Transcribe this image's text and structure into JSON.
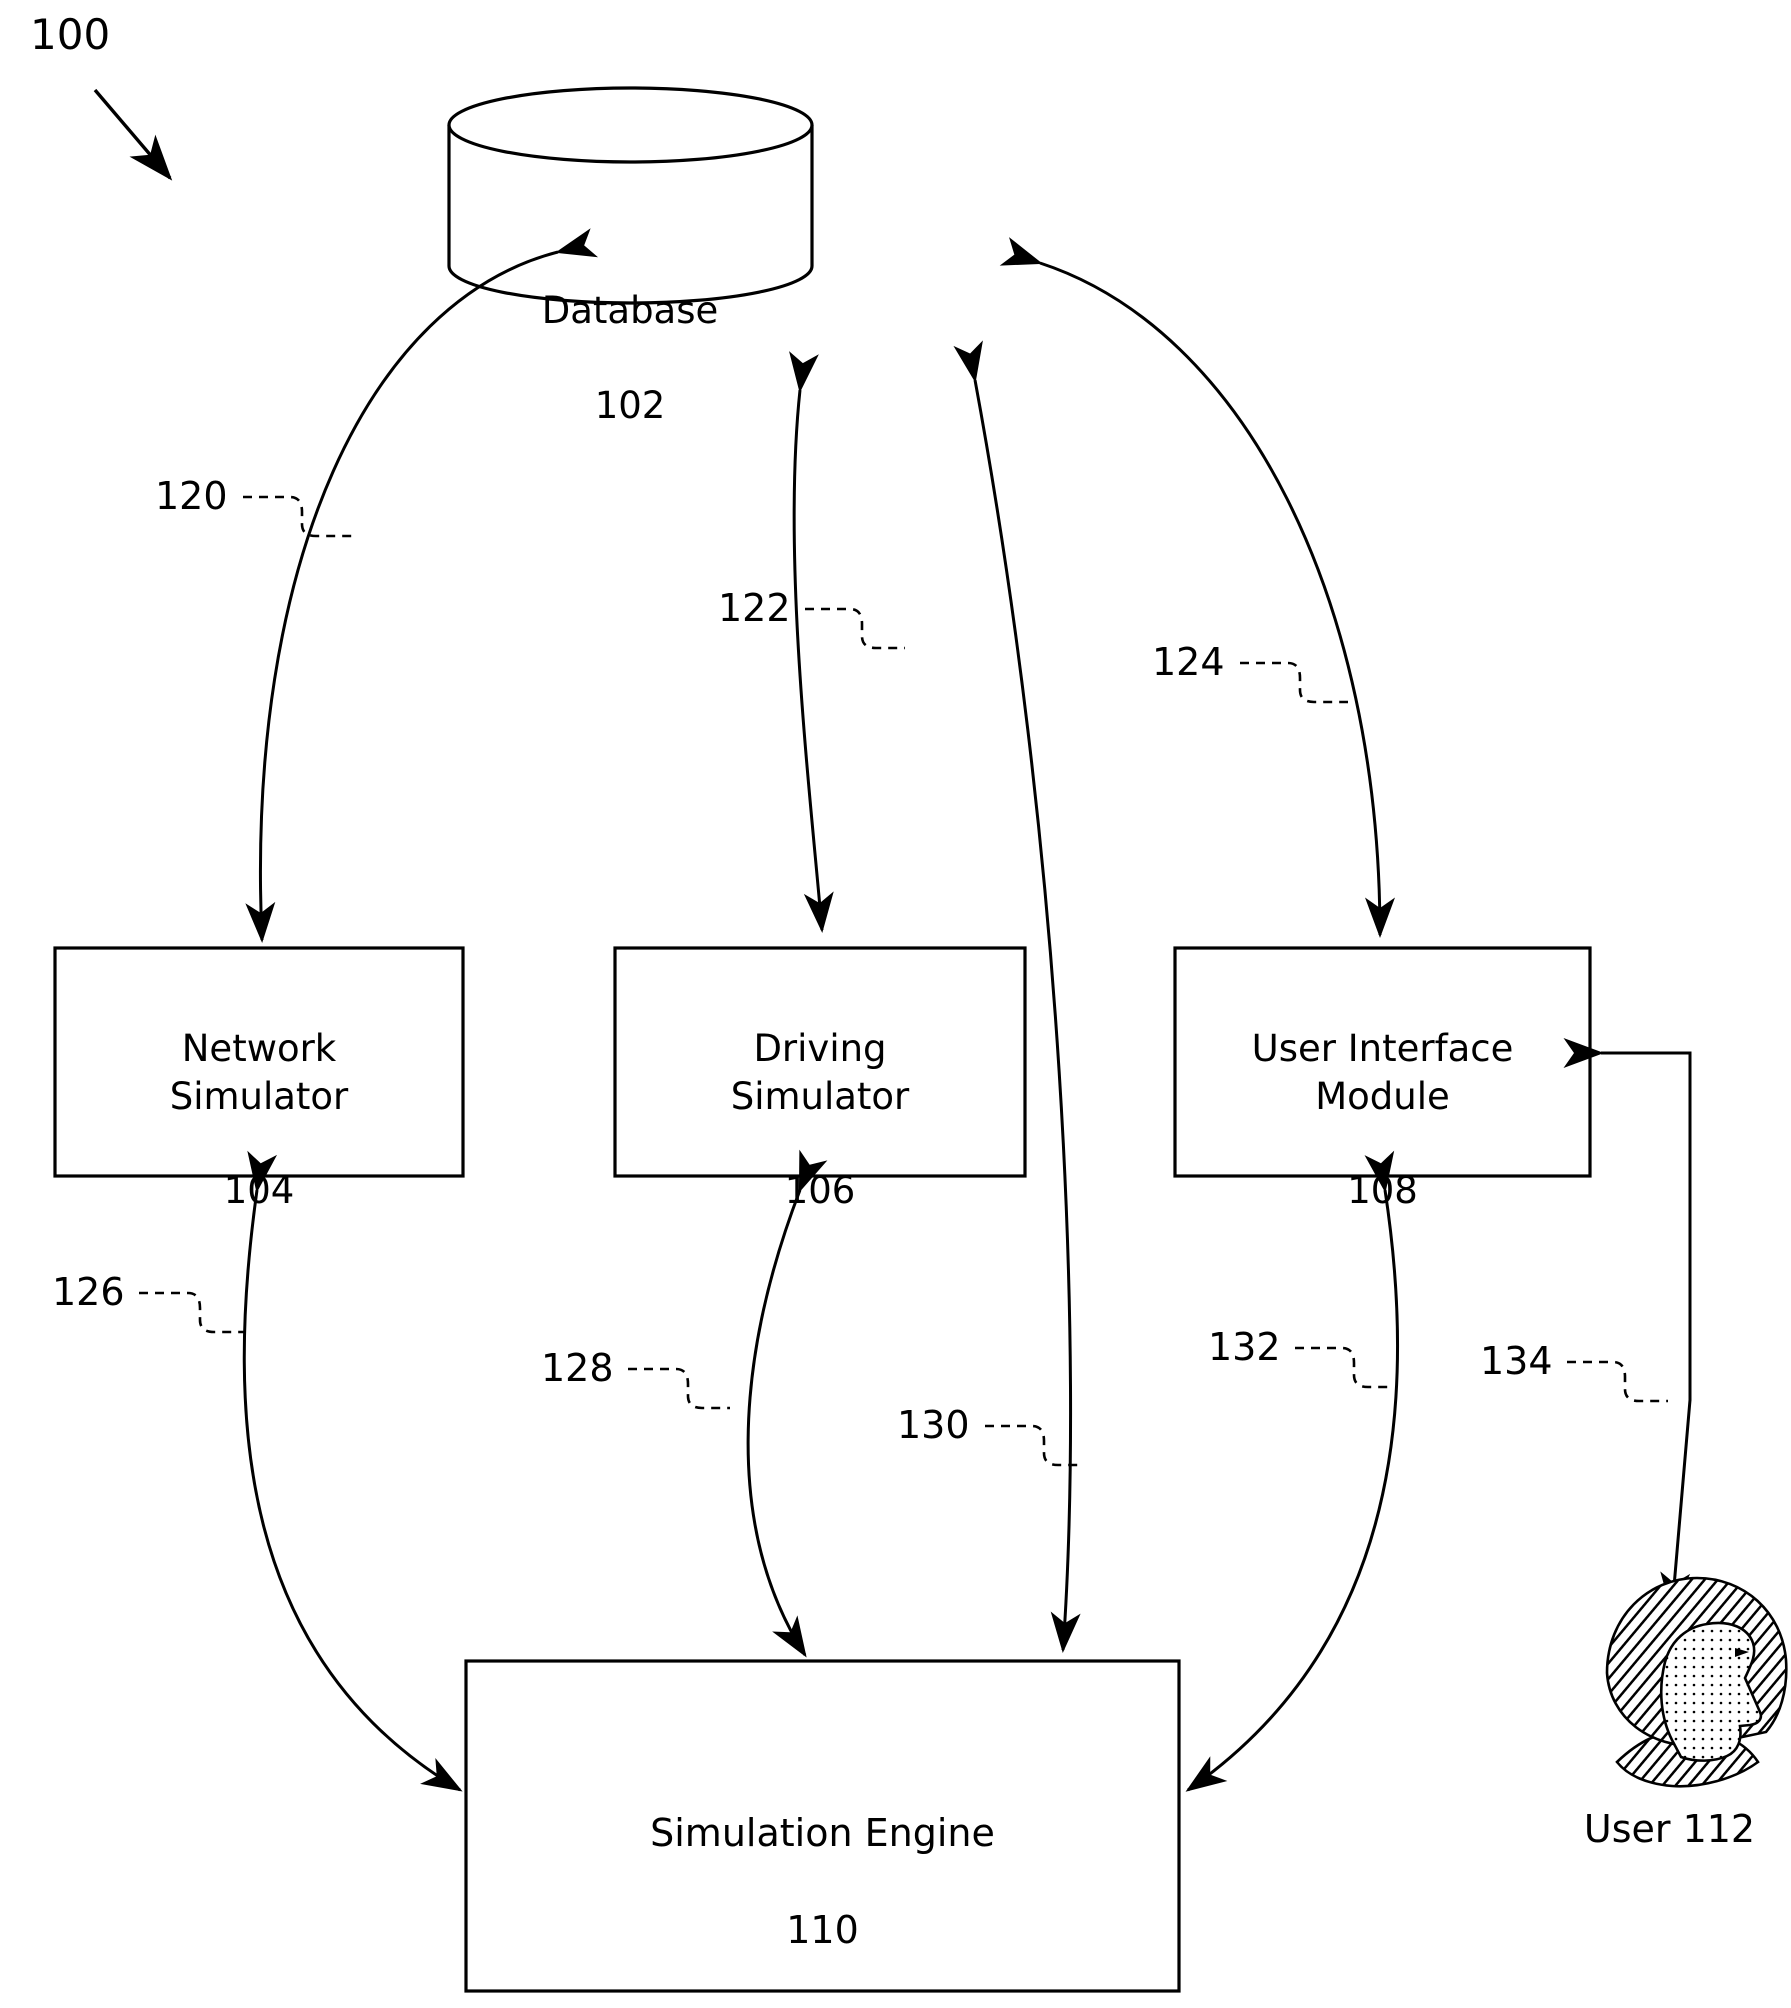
{
  "figure": {
    "number": "100",
    "type": "patent-system-diagram"
  },
  "nodes": {
    "database": {
      "name": "Database",
      "ref": "102",
      "shape": "cylinder"
    },
    "network_simulator": {
      "name": "Network\nSimulator",
      "ref": "104",
      "shape": "rectangle"
    },
    "driving_simulator": {
      "name": "Driving\nSimulator",
      "ref": "106",
      "shape": "rectangle"
    },
    "user_interface_module": {
      "name": "User Interface\nModule",
      "ref": "108",
      "shape": "rectangle"
    },
    "simulation_engine": {
      "name": "Simulation Engine",
      "ref": "110",
      "shape": "rectangle"
    },
    "user": {
      "name": "User 112",
      "ref": "112",
      "shape": "person-icon"
    }
  },
  "connectors": [
    {
      "ref": "120",
      "from": "network_simulator",
      "to": "database",
      "arrows": "both"
    },
    {
      "ref": "122",
      "from": "database",
      "to": "driving_simulator",
      "arrows": "both"
    },
    {
      "ref": "124",
      "from": "user_interface_module",
      "to": "database",
      "arrows": "both"
    },
    {
      "ref": "126",
      "from": "network_simulator",
      "to": "simulation_engine",
      "arrows": "both"
    },
    {
      "ref": "128",
      "from": "driving_simulator",
      "to": "simulation_engine",
      "arrows": "both"
    },
    {
      "ref": "130",
      "from": "simulation_engine",
      "to": "database",
      "arrows": "both"
    },
    {
      "ref": "132",
      "from": "user_interface_module",
      "to": "simulation_engine",
      "arrows": "both"
    },
    {
      "ref": "134",
      "from": "user",
      "to": "user_interface_module",
      "arrows": "both"
    }
  ]
}
